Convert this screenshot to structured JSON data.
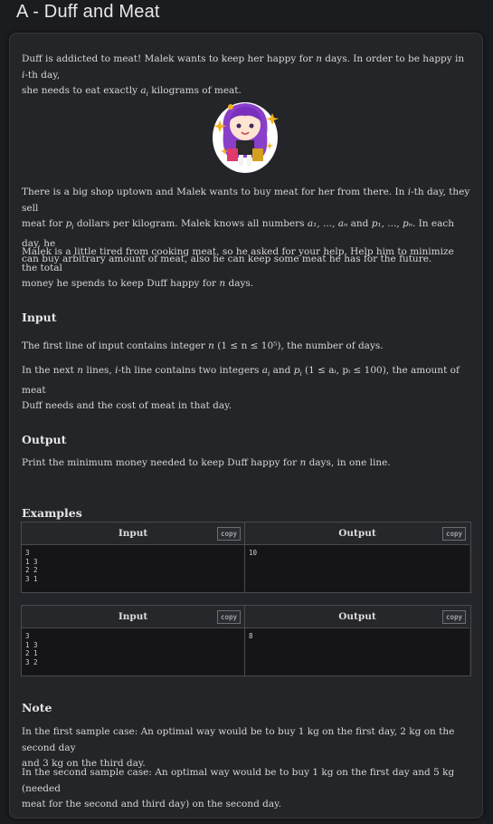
{
  "title": "A - Duff and Meat",
  "legend_p1": "Duff is addicted to meat! Malek wants to keep her happy for n days. In order to be happy in i-th day, she needs to eat exactly a_i kilograms of meat.",
  "p1_line1": "Duff is addicted to meat! Malek wants to keep her happy for ",
  "p1_line1b": " days. In order to be happy in ",
  "p1_line1c": "-th day,",
  "p1_line2a": "she needs to eat exactly ",
  "p1_line2b": " kilograms of meat.",
  "p2_l1a": "There is a big shop uptown and Malek wants to buy meat for her from there. In ",
  "p2_l1b": "-th day, they sell",
  "p2_l2a": "meat for ",
  "p2_l2b": " dollars per kilogram. Malek knows all numbers ",
  "p2_l2c": " and ",
  "p2_l2d": ". In each day, he",
  "p2_l3": "can buy arbitrary amount of meat, also he can keep some meat he has for the future.",
  "p3_l1": "Malek is a little tired from cooking meat, so he asked for your help. Help him to minimize the total",
  "p3_l2a": "money he spends to keep Duff happy for ",
  "p3_l2b": " days.",
  "input_heading": "Input",
  "in_l1a": "The first line of input contains integer ",
  "in_l1b": ", the number of days.",
  "in_l2a": "In the next ",
  "in_l2b": " lines, ",
  "in_l2c": "-th line contains two integers ",
  "in_l2d": " and ",
  "in_l2e": ", the amount of meat",
  "in_l3": "Duff needs and the cost of meat in that day.",
  "output_heading": "Output",
  "out_l1a": "Print the minimum money needed to keep Duff happy for ",
  "out_l1b": " days, in one line.",
  "examples_heading": "Examples",
  "examples": [
    {
      "input_label": "Input",
      "output_label": "Output",
      "copy": "copy",
      "input": "3\n1 3\n2 2\n3 1",
      "output": "10"
    },
    {
      "input_label": "Input",
      "output_label": "Output",
      "copy": "copy",
      "input": "3\n1 3\n2 1\n3 2",
      "output": "8"
    }
  ],
  "note_heading": "Note",
  "note1_l1": "In the first sample case: An optimal way would be to buy 1 kg on the first day, 2 kg on the second day",
  "note1_l2": "and 3 kg on the third day.",
  "note2_l1": "In the second sample case: An optimal way would be to buy 1 kg on the first day and 5 kg (needed",
  "note2_l2": "meat for the second and third day) on the second day.",
  "math": {
    "n": "n",
    "i": "i",
    "a_i": "a",
    "a_i_sub": "i",
    "p_i": "p",
    "p_i_sub": "i",
    "a_list": "a₁, ..., aₙ",
    "p_list": "p₁, ..., pₙ",
    "n_bound": "(1 ≤ n ≤ 10⁵)",
    "ap_bound": "(1 ≤ aᵢ, pᵢ ≤ 100)"
  }
}
